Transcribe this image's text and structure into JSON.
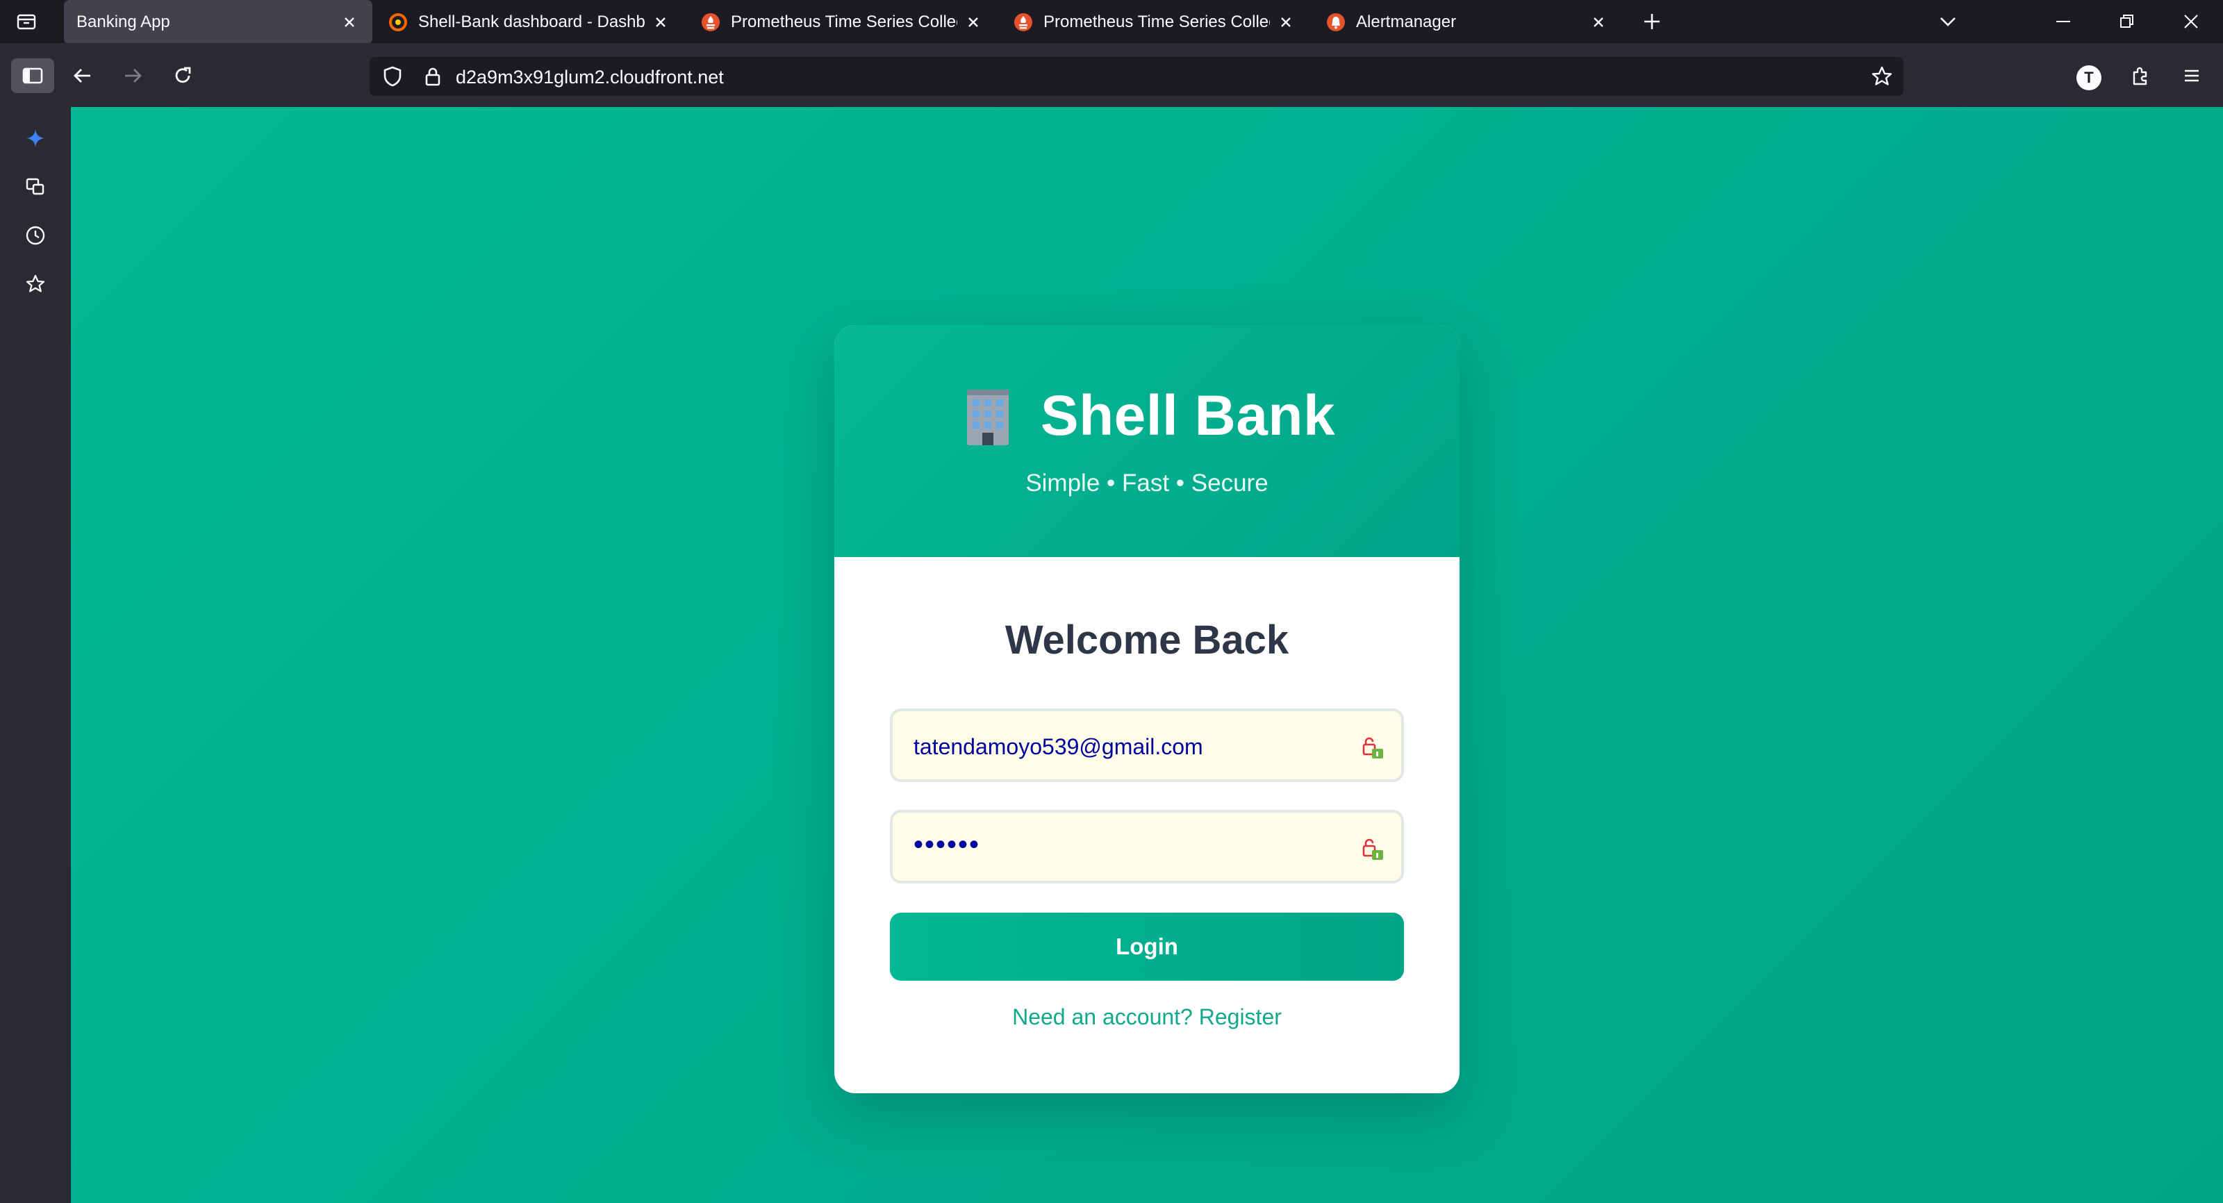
{
  "browser": {
    "tabs": [
      {
        "title": "Banking App",
        "active": true,
        "favicon": "none"
      },
      {
        "title": "Shell-Bank dashboard - Dashbo",
        "active": false,
        "favicon": "grafana-icon"
      },
      {
        "title": "Prometheus Time Series Collect",
        "active": false,
        "favicon": "prometheus-icon"
      },
      {
        "title": "Prometheus Time Series Collect",
        "active": false,
        "favicon": "prometheus-icon"
      },
      {
        "title": "Alertmanager",
        "active": false,
        "favicon": "alertmanager-icon"
      }
    ],
    "url": "d2a9m3x91glum2.cloudfront.net",
    "profile_initial": "T",
    "accent": "#00ad8e"
  },
  "sidebar": {
    "items": [
      "ai-sparkle-icon",
      "synced-tabs-icon",
      "history-icon",
      "bookmarks-icon"
    ]
  },
  "card": {
    "brand_emoji": "🏢",
    "brand_name": "Shell Bank",
    "tagline": "Simple • Fast • Secure",
    "welcome": "Welcome Back",
    "email_value": "tatendamoyo539@gmail.com",
    "password_mask": "••••••",
    "login_label": "Login",
    "register_link": "Need an account? Register"
  }
}
